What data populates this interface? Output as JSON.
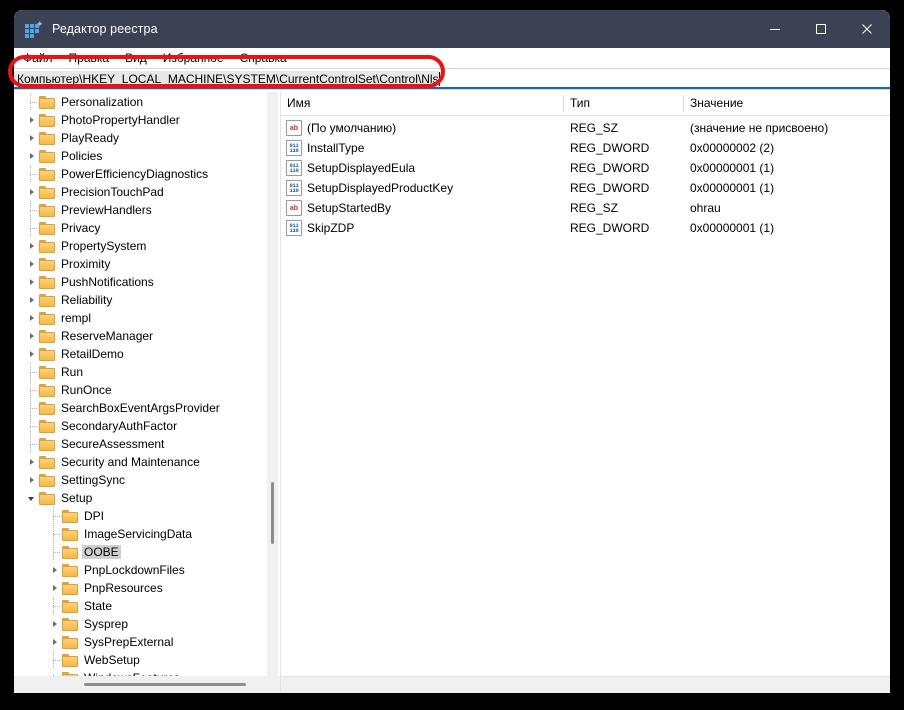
{
  "window": {
    "title": "Редактор реестра",
    "app_icon": "registry-icon",
    "controls": {
      "minimize": "minimize-icon",
      "maximize": "maximize-icon",
      "close": "close-icon"
    }
  },
  "menubar": {
    "items": [
      {
        "label": "Файл"
      },
      {
        "label": "Правка"
      },
      {
        "label": "Вид"
      },
      {
        "label": "Избранное"
      },
      {
        "label": "Справка"
      }
    ]
  },
  "address": {
    "value": "Компьютер\\HKEY_LOCAL_MACHINE\\SYSTEM\\CurrentControlSet\\Control\\Nls",
    "placeholder": "Компьютер\\"
  },
  "tree": {
    "items": [
      {
        "label": "Personalization",
        "indent": 0,
        "expander": "none",
        "selected": false
      },
      {
        "label": "PhotoPropertyHandler",
        "indent": 0,
        "expander": "collapsed",
        "selected": false
      },
      {
        "label": "PlayReady",
        "indent": 0,
        "expander": "collapsed",
        "selected": false
      },
      {
        "label": "Policies",
        "indent": 0,
        "expander": "collapsed",
        "selected": false
      },
      {
        "label": "PowerEfficiencyDiagnostics",
        "indent": 0,
        "expander": "none",
        "selected": false
      },
      {
        "label": "PrecisionTouchPad",
        "indent": 0,
        "expander": "collapsed",
        "selected": false
      },
      {
        "label": "PreviewHandlers",
        "indent": 0,
        "expander": "none",
        "selected": false
      },
      {
        "label": "Privacy",
        "indent": 0,
        "expander": "none",
        "selected": false
      },
      {
        "label": "PropertySystem",
        "indent": 0,
        "expander": "collapsed",
        "selected": false
      },
      {
        "label": "Proximity",
        "indent": 0,
        "expander": "collapsed",
        "selected": false
      },
      {
        "label": "PushNotifications",
        "indent": 0,
        "expander": "collapsed",
        "selected": false
      },
      {
        "label": "Reliability",
        "indent": 0,
        "expander": "collapsed",
        "selected": false
      },
      {
        "label": "rempl",
        "indent": 0,
        "expander": "collapsed",
        "selected": false
      },
      {
        "label": "ReserveManager",
        "indent": 0,
        "expander": "collapsed",
        "selected": false
      },
      {
        "label": "RetailDemo",
        "indent": 0,
        "expander": "collapsed",
        "selected": false
      },
      {
        "label": "Run",
        "indent": 0,
        "expander": "none",
        "selected": false
      },
      {
        "label": "RunOnce",
        "indent": 0,
        "expander": "none",
        "selected": false
      },
      {
        "label": "SearchBoxEventArgsProvider",
        "indent": 0,
        "expander": "none",
        "selected": false
      },
      {
        "label": "SecondaryAuthFactor",
        "indent": 0,
        "expander": "none",
        "selected": false
      },
      {
        "label": "SecureAssessment",
        "indent": 0,
        "expander": "none",
        "selected": false
      },
      {
        "label": "Security and Maintenance",
        "indent": 0,
        "expander": "collapsed",
        "selected": false
      },
      {
        "label": "SettingSync",
        "indent": 0,
        "expander": "collapsed",
        "selected": false
      },
      {
        "label": "Setup",
        "indent": 0,
        "expander": "expanded",
        "selected": false
      },
      {
        "label": "DPI",
        "indent": 1,
        "expander": "none",
        "selected": false
      },
      {
        "label": "ImageServicingData",
        "indent": 1,
        "expander": "none",
        "selected": false
      },
      {
        "label": "OOBE",
        "indent": 1,
        "expander": "none",
        "selected": true
      },
      {
        "label": "PnpLockdownFiles",
        "indent": 1,
        "expander": "collapsed",
        "selected": false
      },
      {
        "label": "PnpResources",
        "indent": 1,
        "expander": "collapsed",
        "selected": false
      },
      {
        "label": "State",
        "indent": 1,
        "expander": "none",
        "selected": false
      },
      {
        "label": "Sysprep",
        "indent": 1,
        "expander": "collapsed",
        "selected": false
      },
      {
        "label": "SysPrepExternal",
        "indent": 1,
        "expander": "collapsed",
        "selected": false
      },
      {
        "label": "WebSetup",
        "indent": 1,
        "expander": "none",
        "selected": false
      },
      {
        "label": "WindowsFeatures",
        "indent": 1,
        "expander": "collapsed",
        "selected": false
      }
    ]
  },
  "values": {
    "columns": {
      "name": "Имя",
      "type": "Тип",
      "value": "Значение"
    },
    "rows": [
      {
        "icon": "string-value-icon",
        "name": "(По умолчанию)",
        "type": "REG_SZ",
        "value": "(значение не присвоено)"
      },
      {
        "icon": "dword-value-icon",
        "name": "InstallType",
        "type": "REG_DWORD",
        "value": "0x00000002 (2)"
      },
      {
        "icon": "dword-value-icon",
        "name": "SetupDisplayedEula",
        "type": "REG_DWORD",
        "value": "0x00000001 (1)"
      },
      {
        "icon": "dword-value-icon",
        "name": "SetupDisplayedProductKey",
        "type": "REG_DWORD",
        "value": "0x00000001 (1)"
      },
      {
        "icon": "string-value-icon",
        "name": "SetupStartedBy",
        "type": "REG_SZ",
        "value": "ohrau"
      },
      {
        "icon": "dword-value-icon",
        "name": "SkipZDP",
        "type": "REG_DWORD",
        "value": "0x00000001 (1)"
      }
    ]
  },
  "annotation": {
    "color": "#ee1111",
    "target": "address-bar"
  },
  "colors": {
    "titlebar": "#3b4253",
    "accent": "#1565c0",
    "folder": "#f7b93f",
    "selection": "#cfcfcf"
  }
}
